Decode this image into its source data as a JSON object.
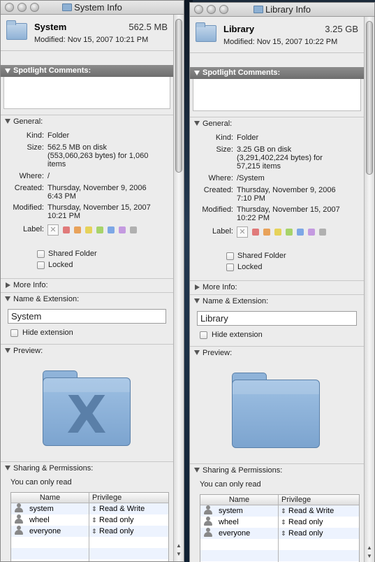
{
  "windows": [
    {
      "title": "System Info",
      "name": "System",
      "size": "562.5 MB",
      "modified": "Modified: Nov 15, 2007 10:21 PM",
      "spotlight_label": "Spotlight Comments:",
      "general_label": "General:",
      "kind_label": "Kind:",
      "kind": "Folder",
      "size_label": "Size:",
      "size_line1": "562.5 MB on disk",
      "size_line2": "(553,060,263 bytes) for 1,060",
      "size_line3": "items",
      "where_label": "Where:",
      "where": "/",
      "created_label": "Created:",
      "created_line1": "Thursday, November 9, 2006",
      "created_line2": "6:43 PM",
      "modified_label": "Modified:",
      "modified_line1": "Thursday, November 15, 2007",
      "modified_line2": "10:21 PM",
      "label_label": "Label:",
      "shared_folder": "Shared Folder",
      "locked": "Locked",
      "more_info": "More Info:",
      "name_ext": "Name & Extension:",
      "name_field": "System",
      "hide_ext": "Hide extension",
      "preview": "Preview:",
      "preview_glyph": "X",
      "sharing": "Sharing & Permissions:",
      "perm_note": "You can only read",
      "col_name": "Name",
      "col_priv": "Privilege",
      "perms": [
        {
          "name": "system",
          "priv": "Read & Write"
        },
        {
          "name": "wheel",
          "priv": "Read only"
        },
        {
          "name": "everyone",
          "priv": "Read only"
        }
      ]
    },
    {
      "title": "Library Info",
      "name": "Library",
      "size": "3.25 GB",
      "modified": "Modified: Nov 15, 2007 10:22 PM",
      "spotlight_label": "Spotlight Comments:",
      "general_label": "General:",
      "kind_label": "Kind:",
      "kind": "Folder",
      "size_label": "Size:",
      "size_line1": "3.25 GB on disk",
      "size_line2": "(3,291,402,224 bytes) for",
      "size_line3": "57,215 items",
      "where_label": "Where:",
      "where": "/System",
      "created_label": "Created:",
      "created_line1": "Thursday, November 9, 2006",
      "created_line2": "7:10 PM",
      "modified_label": "Modified:",
      "modified_line1": "Thursday, November 15, 2007",
      "modified_line2": "10:22 PM",
      "label_label": "Label:",
      "shared_folder": "Shared Folder",
      "locked": "Locked",
      "more_info": "More Info:",
      "name_ext": "Name & Extension:",
      "name_field": "Library",
      "hide_ext": "Hide extension",
      "preview": "Preview:",
      "preview_glyph": "",
      "sharing": "Sharing & Permissions:",
      "perm_note": "You can only read",
      "col_name": "Name",
      "col_priv": "Privilege",
      "perms": [
        {
          "name": "system",
          "priv": "Read & Write"
        },
        {
          "name": "wheel",
          "priv": "Read only"
        },
        {
          "name": "everyone",
          "priv": "Read only"
        }
      ]
    }
  ],
  "label_colors": [
    "#e07a7a",
    "#e8a25a",
    "#e6d25a",
    "#a7d36a",
    "#7da7e6",
    "#c49ae0",
    "#b0b0b0"
  ],
  "icons": {
    "window_icon": "folder-icon",
    "user_single": "user-icon",
    "user_group": "group-icon"
  }
}
